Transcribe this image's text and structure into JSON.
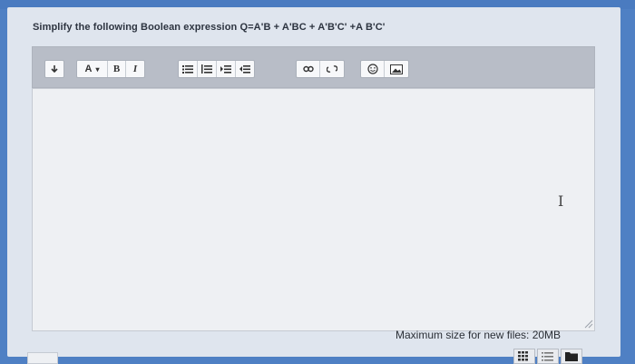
{
  "question": {
    "text": "Simplify the following Boolean expression Q=A'B + A'BC + A'B'C' +A B'C'"
  },
  "toolbar": {
    "collapse_icon": "arrow-down-icon",
    "font_color_label": "A",
    "bold_label": "B",
    "italic_label": "I",
    "list_buttons": [
      "unordered-list-icon",
      "ordered-list-icon",
      "indent-icon",
      "outdent-icon"
    ],
    "link_buttons": [
      "link-icon",
      "unlink-icon"
    ],
    "media_buttons": [
      "emoticon-icon",
      "image-icon"
    ]
  },
  "editor": {
    "content": ""
  },
  "files": {
    "max_size_text": "Maximum size for new files: 20MB"
  },
  "colors": {
    "frame": "#4f80c4",
    "card": "#dfe5ee",
    "toolbar": "#b8bdc7",
    "editor_bg": "#eef0f3"
  }
}
